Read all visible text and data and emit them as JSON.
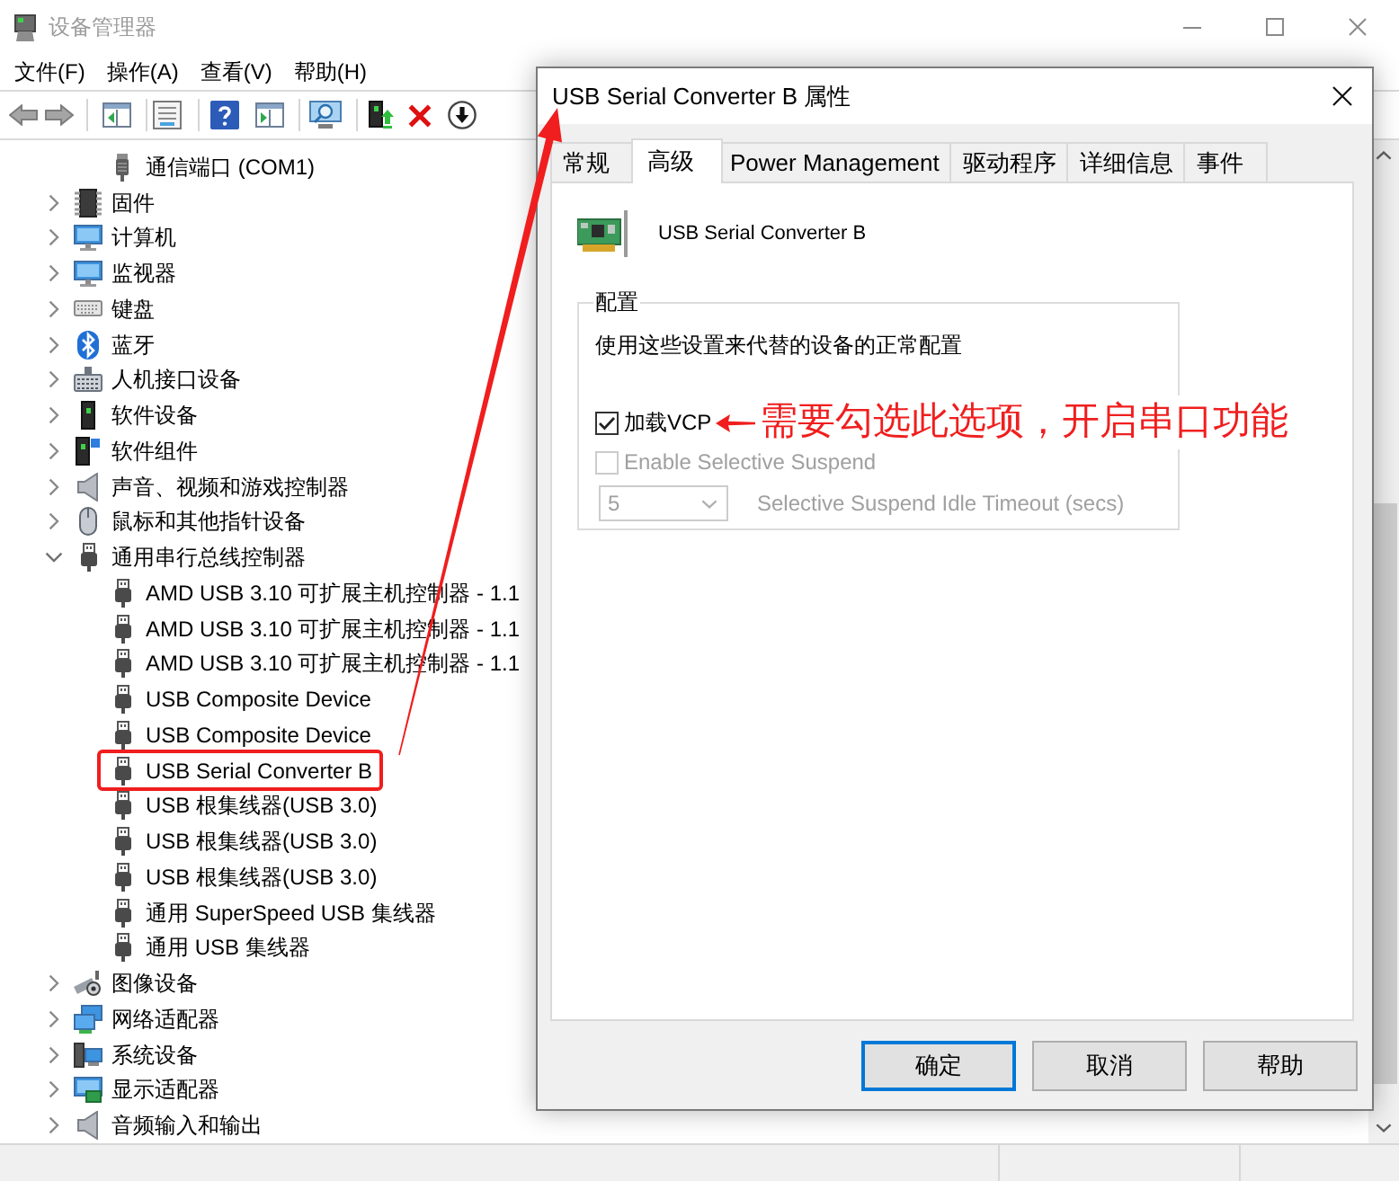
{
  "window": {
    "title": "设备管理器"
  },
  "menu": [
    "文件(F)",
    "操作(A)",
    "查看(V)",
    "帮助(H)"
  ],
  "tree": {
    "items": [
      {
        "children": [
          {
            "kind": "port",
            "label": "通信端口 (COM1)"
          }
        ]
      },
      {
        "kind": "chip",
        "label": "固件",
        "expanded": false
      },
      {
        "kind": "computer",
        "label": "计算机",
        "expanded": false
      },
      {
        "kind": "monitor",
        "label": "监视器",
        "expanded": false
      },
      {
        "kind": "keyboard",
        "label": "键盘",
        "expanded": false
      },
      {
        "kind": "bluetooth",
        "label": "蓝牙",
        "expanded": false
      },
      {
        "kind": "hid",
        "label": "人机接口设备",
        "expanded": false
      },
      {
        "kind": "device",
        "label": "软件设备",
        "expanded": false
      },
      {
        "kind": "component",
        "label": "软件组件",
        "expanded": false
      },
      {
        "kind": "speaker",
        "label": "声音、视频和游戏控制器",
        "expanded": false
      },
      {
        "kind": "mouse",
        "label": "鼠标和其他指针设备",
        "expanded": false
      },
      {
        "kind": "usb",
        "label": "通用串行总线控制器",
        "expanded": true,
        "children": [
          {
            "kind": "usb",
            "label": "AMD USB 3.10 可扩展主机控制器 - 1.1",
            "marked": false
          },
          {
            "kind": "usb",
            "label": "AMD USB 3.10 可扩展主机控制器 - 1.1",
            "marked": false
          },
          {
            "kind": "usb",
            "label": "AMD USB 3.10 可扩展主机控制器 - 1.1",
            "marked": false
          },
          {
            "kind": "usb",
            "label": "USB Composite Device",
            "marked": false
          },
          {
            "kind": "usb",
            "label": "USB Composite Device",
            "marked": false
          },
          {
            "kind": "usb",
            "label": "USB Serial Converter B",
            "marked": true
          },
          {
            "kind": "usb",
            "label": "USB 根集线器(USB 3.0)",
            "marked": false
          },
          {
            "kind": "usb",
            "label": "USB 根集线器(USB 3.0)",
            "marked": false
          },
          {
            "kind": "usb",
            "label": "USB 根集线器(USB 3.0)",
            "marked": false
          },
          {
            "kind": "usb",
            "label": "通用 SuperSpeed USB 集线器",
            "marked": false
          },
          {
            "kind": "usb",
            "label": "通用 USB 集线器",
            "marked": false
          }
        ]
      },
      {
        "kind": "camera",
        "label": "图像设备",
        "expanded": false
      },
      {
        "kind": "network",
        "label": "网络适配器",
        "expanded": false
      },
      {
        "kind": "system",
        "label": "系统设备",
        "expanded": false
      },
      {
        "kind": "display",
        "label": "显示适配器",
        "expanded": false
      },
      {
        "kind": "audio",
        "label": "音频输入和输出",
        "expanded": false
      }
    ]
  },
  "dialog": {
    "title": "USB Serial Converter B 属性",
    "tabs": [
      {
        "label": "常规",
        "selected": false
      },
      {
        "label": "高级",
        "selected": true
      },
      {
        "label": "Power Management",
        "selected": false
      },
      {
        "label": "驱动程序",
        "selected": false
      },
      {
        "label": "详细信息",
        "selected": false
      },
      {
        "label": "事件",
        "selected": false
      }
    ],
    "device_name": "USB Serial Converter B",
    "group": {
      "title": "配置",
      "description": "使用这些设置来代替的设备的正常配置",
      "options": [
        {
          "kind": "checkbox",
          "label": "加载VCP",
          "checked": true,
          "disabled": false,
          "annotation": "需要勾选此选项，开启串口功能"
        },
        {
          "kind": "checkbox",
          "label": "Enable Selective Suspend",
          "checked": false,
          "disabled": true
        },
        {
          "kind": "dropdown",
          "value": "5",
          "caption": "Selective Suspend Idle Timeout (secs)",
          "disabled": true
        }
      ]
    },
    "buttons": [
      {
        "label": "确定",
        "default": true
      },
      {
        "label": "取消",
        "default": false
      },
      {
        "label": "帮助",
        "default": false
      }
    ]
  }
}
